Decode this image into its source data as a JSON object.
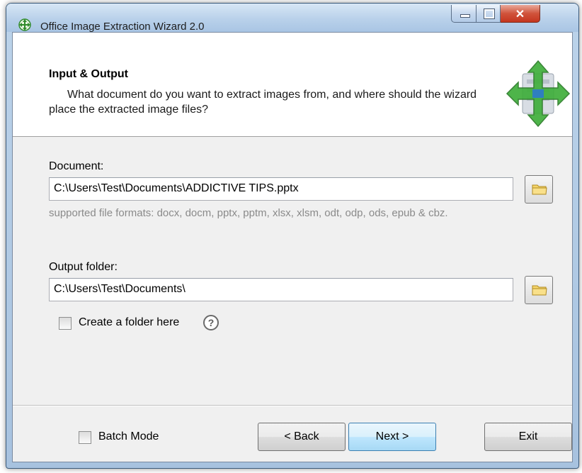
{
  "window": {
    "title": "Office Image Extraction Wizard 2.0",
    "icon": "move-arrows-icon",
    "controls": [
      "minimize-icon",
      "maximize-icon",
      "close-icon"
    ]
  },
  "header": {
    "title": "Input & Output",
    "description": "What document do you want to extract images from, and where should the wizard place the extracted image files?",
    "icon": "four-way-arrows-icon"
  },
  "document": {
    "label": "Document:",
    "value": "C:\\Users\\Test\\Documents\\ADDICTIVE TIPS.pptx",
    "hint": "supported file formats: docx, docm, pptx, pptm, xlsx, xlsm, odt, odp, ods, epub & cbz."
  },
  "output": {
    "label": "Output folder:",
    "value": "C:\\Users\\Test\\Documents\\",
    "create_folder_label": "Create a folder here",
    "create_folder_checked": false,
    "help_glyph": "?"
  },
  "footer": {
    "batch_mode_label": "Batch Mode",
    "batch_mode_checked": false,
    "back_label": "< Back",
    "next_label": "Next >",
    "exit_label": "Exit"
  },
  "colors": {
    "accent": "#3c7fb1",
    "close_button": "#c5361f",
    "arrow_green": "#3fae3b"
  }
}
